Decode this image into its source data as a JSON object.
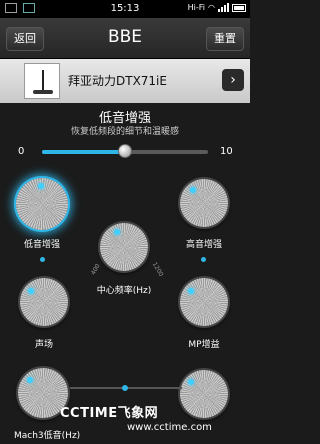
{
  "status": {
    "time": "15:13",
    "network": "Hi-Fi"
  },
  "header": {
    "back": "返回",
    "title": "BBE",
    "reset": "重置"
  },
  "device": {
    "name": "拜亚动力DTX71iE"
  },
  "section": {
    "title": "低音增强",
    "subtitle": "恢复低频段的细节和温暖感"
  },
  "slider": {
    "min": "0",
    "max": "10",
    "value": 5
  },
  "knobs": {
    "bass_boost": "低音增强",
    "treble_boost": "高音增强",
    "center_freq": "中心频率(Hz)",
    "sound_field": "声场",
    "mp_boost": "MP增益",
    "mach3_bass": "Mach3低音(Hz)"
  },
  "freq_ticks": [
    "400",
    "1200"
  ],
  "watermark": {
    "line1": "CCTIME飞象网",
    "line2": "www.cctime.com"
  },
  "colors": {
    "accent": "#2fb6e8"
  }
}
